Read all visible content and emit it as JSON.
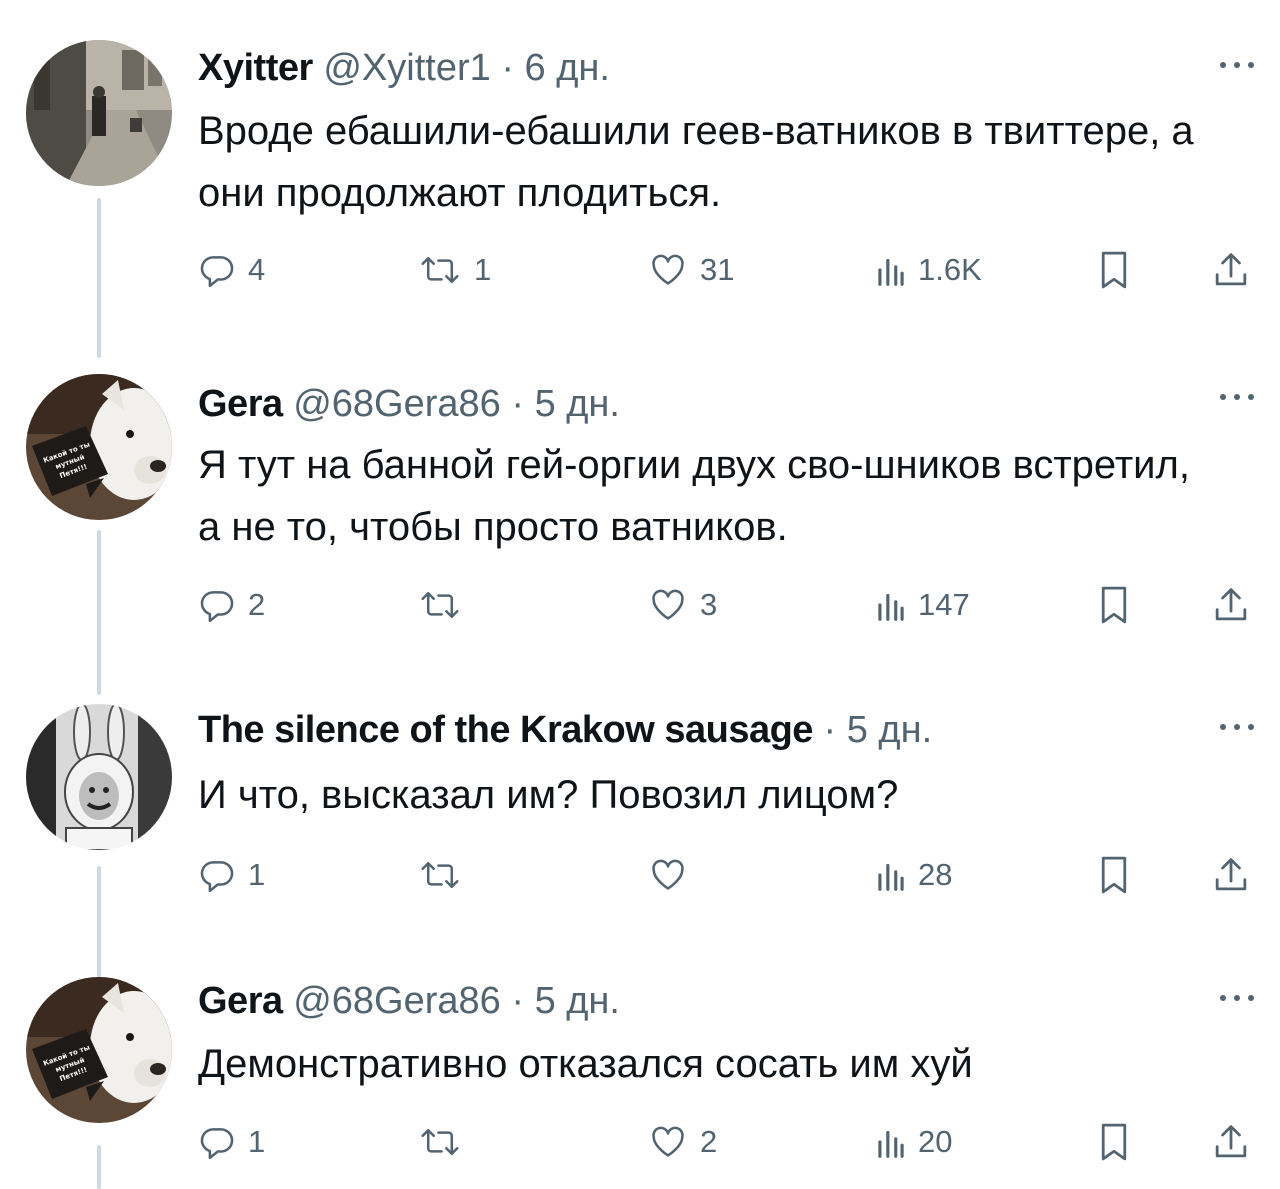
{
  "tweets": [
    {
      "name": "Xyitter",
      "handle": "@Xyitter1",
      "time": "6 дн.",
      "text": "Вроде ебашили-ебашили геев-ватников в твиттере, а они продолжают плодиться.",
      "replies": "4",
      "retweets": "1",
      "likes": "31",
      "views": "1.6K"
    },
    {
      "name": "Gera",
      "handle": "@68Gera86",
      "time": "5 дн.",
      "text": "Я тут на банной гей-оргии двух сво-шников встретил, а не то, чтобы просто ватников.",
      "replies": "2",
      "retweets": "",
      "likes": "3",
      "views": "147"
    },
    {
      "name": "The silence of the Krakow sausage",
      "handle": "",
      "time": "5 дн.",
      "text": "И что, высказал им? Повозил лицом?",
      "replies": "1",
      "retweets": "",
      "likes": "",
      "views": "28"
    },
    {
      "name": "Gera",
      "handle": "@68Gera86",
      "time": "5 дн.",
      "text": "Демонстративно отказался сосать им хуй",
      "replies": "1",
      "retweets": "",
      "likes": "2",
      "views": "20"
    }
  ],
  "avatar_sign_text": [
    "Какой то ты",
    "мутный",
    "Петя!!!"
  ],
  "colors": {
    "text": "#0f1419",
    "secondary": "#536471",
    "thread_line": "#cfd9de",
    "background": "#ffffff"
  },
  "icons": [
    "reply-icon",
    "retweet-icon",
    "like-icon",
    "views-icon",
    "bookmark-icon",
    "share-icon",
    "more-icon"
  ]
}
